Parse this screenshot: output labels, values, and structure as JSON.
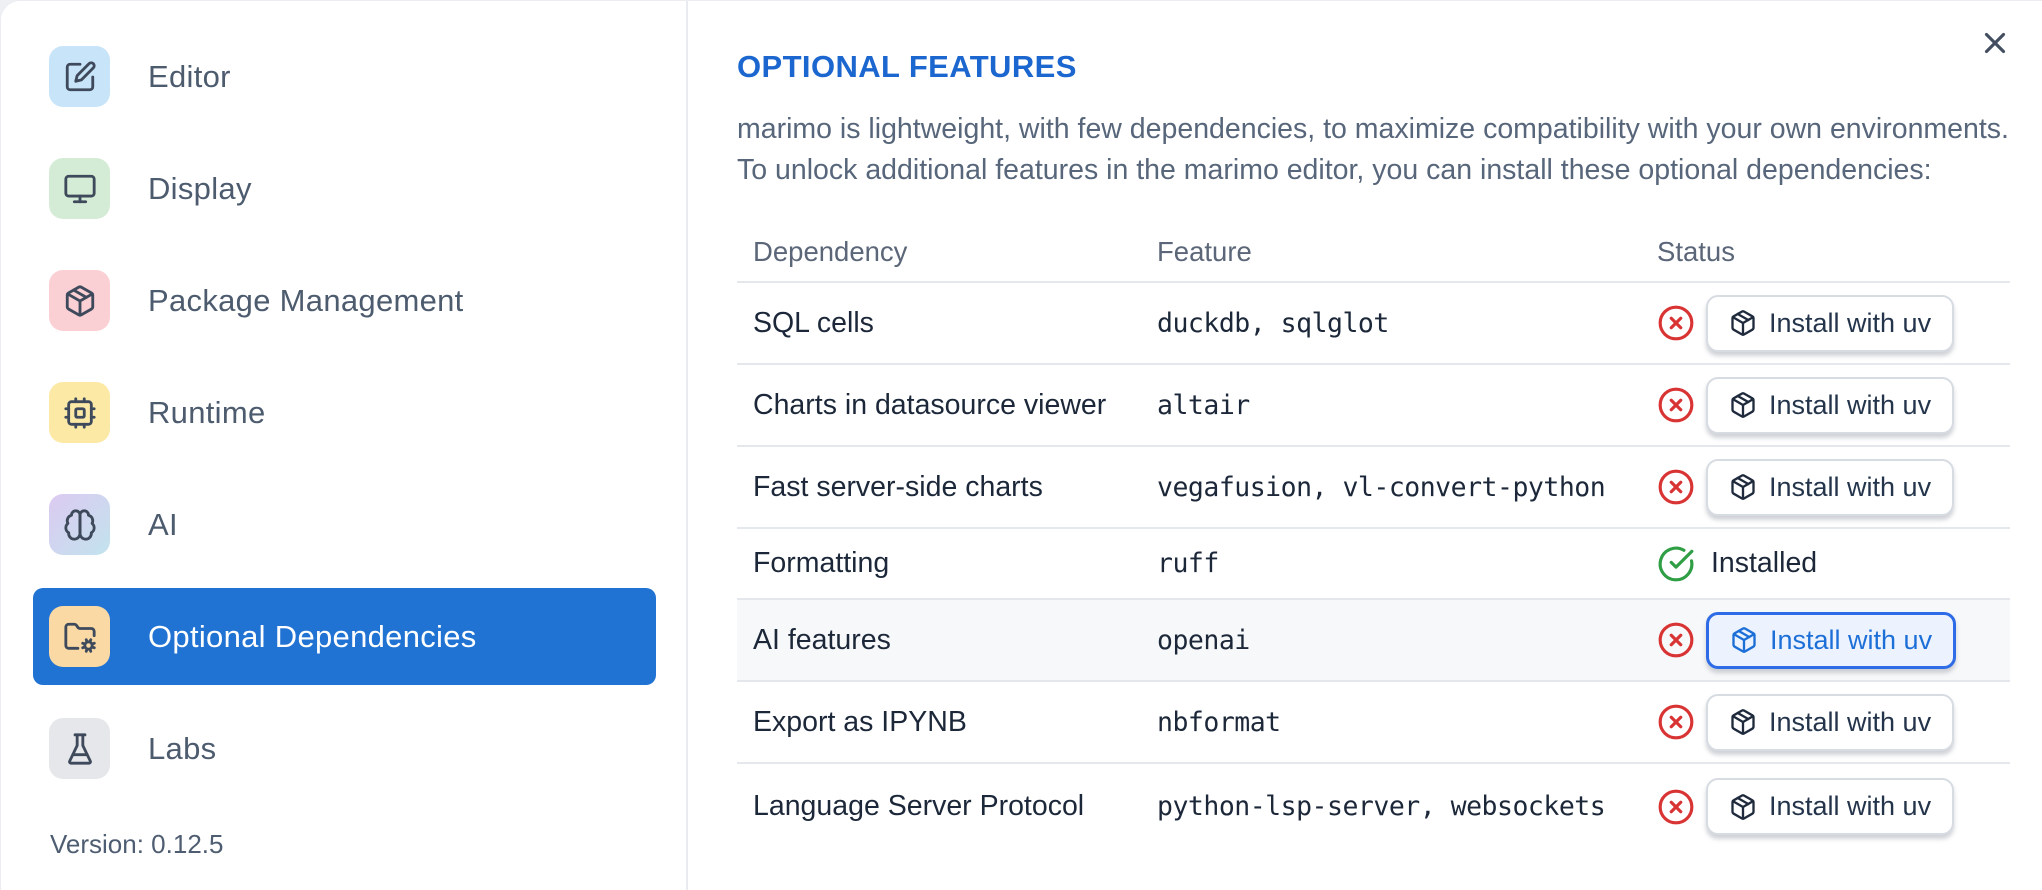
{
  "dialog": {
    "close_icon": "x-icon"
  },
  "sidebar": {
    "items": [
      {
        "label": "Editor",
        "icon": "square-pen-icon",
        "tile_color": "#c8e4f9",
        "selected": false
      },
      {
        "label": "Display",
        "icon": "monitor-icon",
        "tile_color": "#d4ecd5",
        "selected": false
      },
      {
        "label": "Package Management",
        "icon": "package-icon",
        "tile_color": "#fbd0d4",
        "selected": false
      },
      {
        "label": "Runtime",
        "icon": "cpu-icon",
        "tile_color": "#fce9a6",
        "selected": false
      },
      {
        "label": "AI",
        "icon": "brain-icon",
        "tile_color": "linear-gradient #dccaf1 to #c2e3ed",
        "selected": false
      },
      {
        "label": "Optional Dependencies",
        "icon": "folder-cog-icon",
        "tile_color": "#fbd9a4",
        "selected": true
      },
      {
        "label": "Labs",
        "icon": "flask-icon",
        "tile_color": "#e6e7ea",
        "selected": false
      }
    ],
    "version_label": "Version: 0.12.5"
  },
  "main": {
    "title": "OPTIONAL FEATURES",
    "description_line1": "marimo is lightweight, with few dependencies, to maximize compatibility with your own environments.",
    "description_line2": "To unlock additional features in the marimo editor, you can install these optional dependencies:",
    "table": {
      "headers": [
        "Dependency",
        "Feature",
        "Status"
      ],
      "rows": [
        {
          "dependency": "SQL cells",
          "feature": "duckdb, sqlglot",
          "status": "missing",
          "status_icon": "circle-x-icon",
          "action": "Install with uv",
          "highlighted": false
        },
        {
          "dependency": "Charts in datasource viewer",
          "feature": "altair",
          "status": "missing",
          "status_icon": "circle-x-icon",
          "action": "Install with uv",
          "highlighted": false
        },
        {
          "dependency": "Fast server-side charts",
          "feature": "vegafusion, vl-convert-python",
          "status": "missing",
          "status_icon": "circle-x-icon",
          "action": "Install with uv",
          "highlighted": false
        },
        {
          "dependency": "Formatting",
          "feature": "ruff",
          "status": "installed",
          "status_icon": "circle-check-icon",
          "status_label": "Installed",
          "highlighted": false
        },
        {
          "dependency": "AI features",
          "feature": "openai",
          "status": "missing",
          "status_icon": "circle-x-icon",
          "action": "Install with uv",
          "highlighted": true,
          "button_focused": true
        },
        {
          "dependency": "Export as IPYNB",
          "feature": "nbformat",
          "status": "missing",
          "status_icon": "circle-x-icon",
          "action": "Install with uv",
          "highlighted": false
        },
        {
          "dependency": "Language Server Protocol",
          "feature": "python-lsp-server, websockets",
          "status": "missing",
          "status_icon": "circle-x-icon",
          "action": "Install with uv",
          "highlighted": false
        }
      ]
    }
  },
  "colors": {
    "selected_item_blue": "#2173d3",
    "title_blue": "#1b66cf",
    "focused_button_blue": "#2e6be6",
    "error_red": "#d93434",
    "success_green": "#2f9e44"
  }
}
